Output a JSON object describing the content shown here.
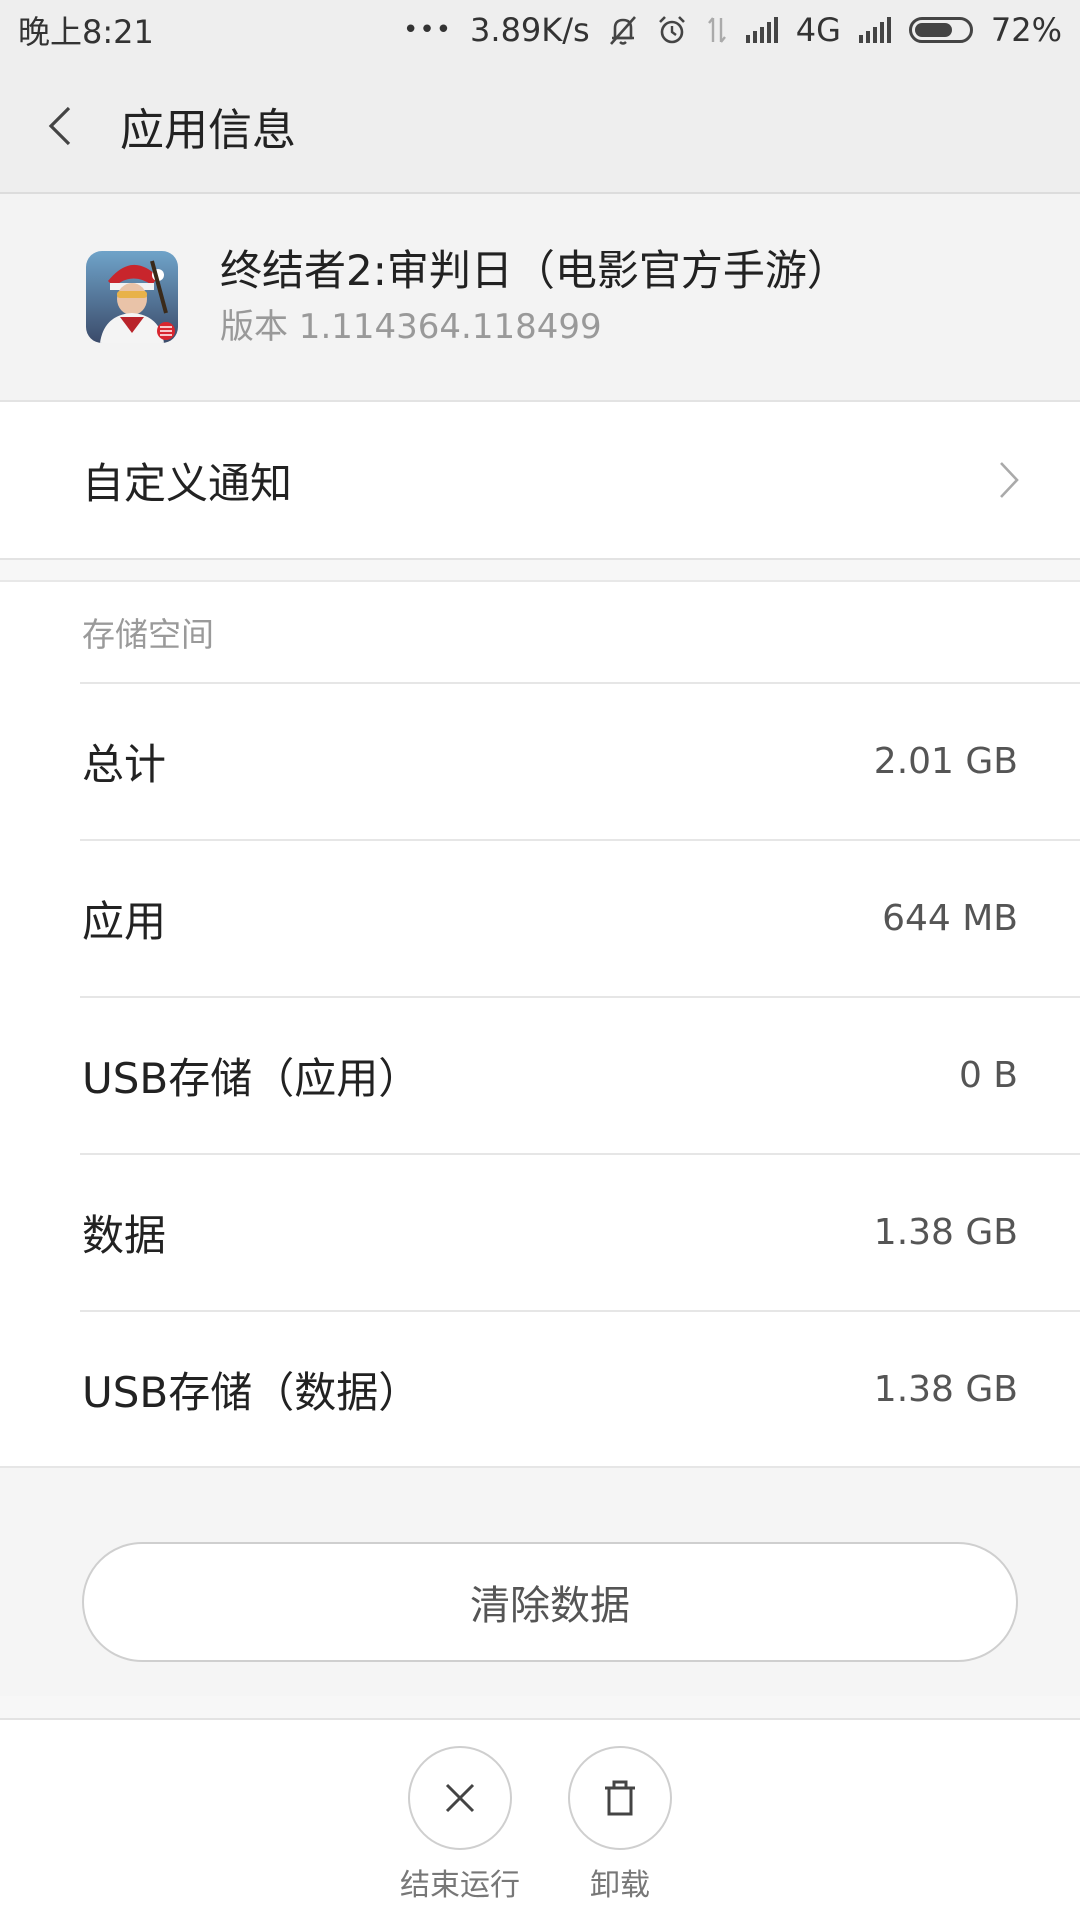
{
  "status_bar": {
    "time": "晚上8:21",
    "dots": "•••",
    "speed": "3.89K/s",
    "network": "4G",
    "battery_percent": "72%",
    "battery_level": 0.72,
    "icons": [
      "mute-bell-icon",
      "alarm-icon",
      "data-arrows-icon",
      "signal-icon",
      "signal-icon",
      "battery-icon"
    ]
  },
  "header": {
    "title": "应用信息"
  },
  "app": {
    "name": "终结者2:审判日（电影官方手游）",
    "version": "版本 1.114364.118499"
  },
  "notification": {
    "label": "自定义通知"
  },
  "storage": {
    "section_title": "存储空间",
    "rows": [
      {
        "label": "总计",
        "value": "2.01 GB"
      },
      {
        "label": "应用",
        "value": "644 MB"
      },
      {
        "label": "USB存储（应用）",
        "value": "0 B"
      },
      {
        "label": "数据",
        "value": "1.38 GB"
      },
      {
        "label": "USB存储（数据）",
        "value": "1.38 GB"
      }
    ]
  },
  "actions": {
    "clear_data": "清除数据",
    "force_stop": "结束运行",
    "uninstall": "卸载"
  }
}
